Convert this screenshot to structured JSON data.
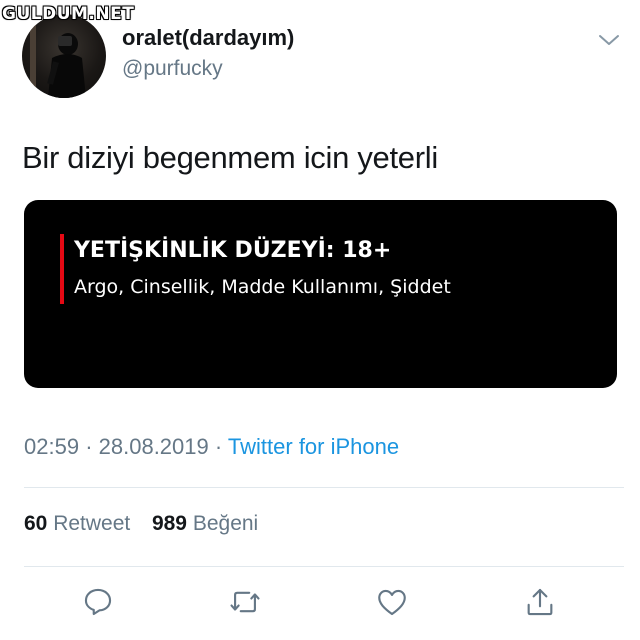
{
  "watermark": {
    "text": "GULDUM.NET"
  },
  "user": {
    "display_name": "oralet(dardayım)",
    "handle": "@purfucky"
  },
  "header": {
    "menu_icon": "chevron-down-icon"
  },
  "tweet": {
    "text": "Bir diziyi begenmem icin yeterli",
    "media": {
      "rating_title": "YETİŞKİNLİK DÜZEYİ: 18+",
      "rating_description": "Argo, Cinsellik, Madde Kullanımı, Şiddet",
      "accent_color": "#e50914"
    },
    "time": "02:59",
    "date": "28.08.2019",
    "separator": "·",
    "source": "Twitter for iPhone"
  },
  "stats": {
    "retweet_count": "60",
    "retweet_label": "Retweet",
    "like_count": "989",
    "like_label": "Beğeni"
  },
  "actions": [
    "reply-icon",
    "retweet-icon",
    "like-icon",
    "share-icon"
  ],
  "colors": {
    "text": "#14171a",
    "secondary": "#657786",
    "link": "#1b95e0",
    "divider": "#e1e8ed"
  }
}
